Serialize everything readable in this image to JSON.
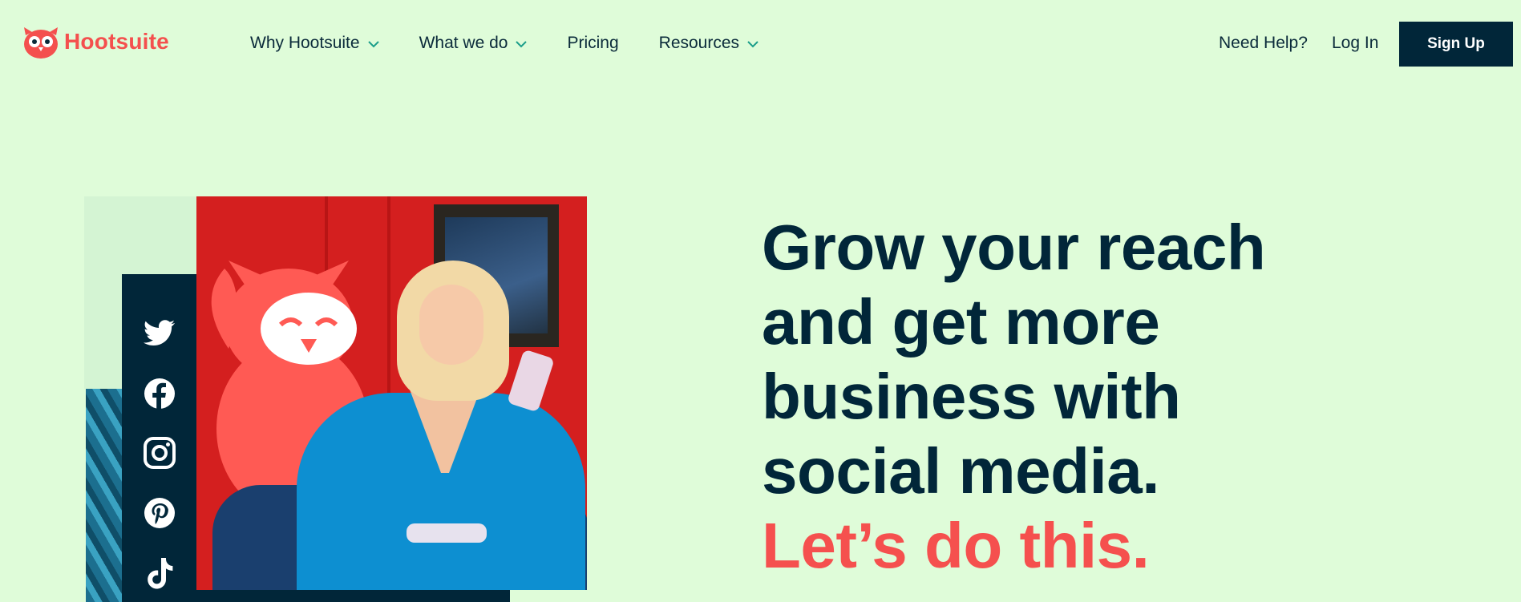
{
  "header": {
    "logo_text": "Hootsuite",
    "nav": [
      {
        "label": "Why Hootsuite",
        "has_dropdown": true
      },
      {
        "label": "What we do",
        "has_dropdown": true
      },
      {
        "label": "Pricing",
        "has_dropdown": false
      },
      {
        "label": "Resources",
        "has_dropdown": true
      }
    ],
    "help_label": "Need Help?",
    "login_label": "Log In",
    "signup_label": "Sign Up"
  },
  "hero": {
    "headline_lines": [
      "Grow your reach",
      "and get more",
      "business with",
      "social media."
    ],
    "accent_line": "Let’s do this.",
    "social_icons": [
      "twitter-icon",
      "facebook-icon",
      "instagram-icon",
      "pinterest-icon",
      "tiktok-icon"
    ]
  },
  "colors": {
    "background": "#dffcd9",
    "brand": "#f4504e",
    "dark": "#012639",
    "chevron": "#1b9e8a"
  }
}
